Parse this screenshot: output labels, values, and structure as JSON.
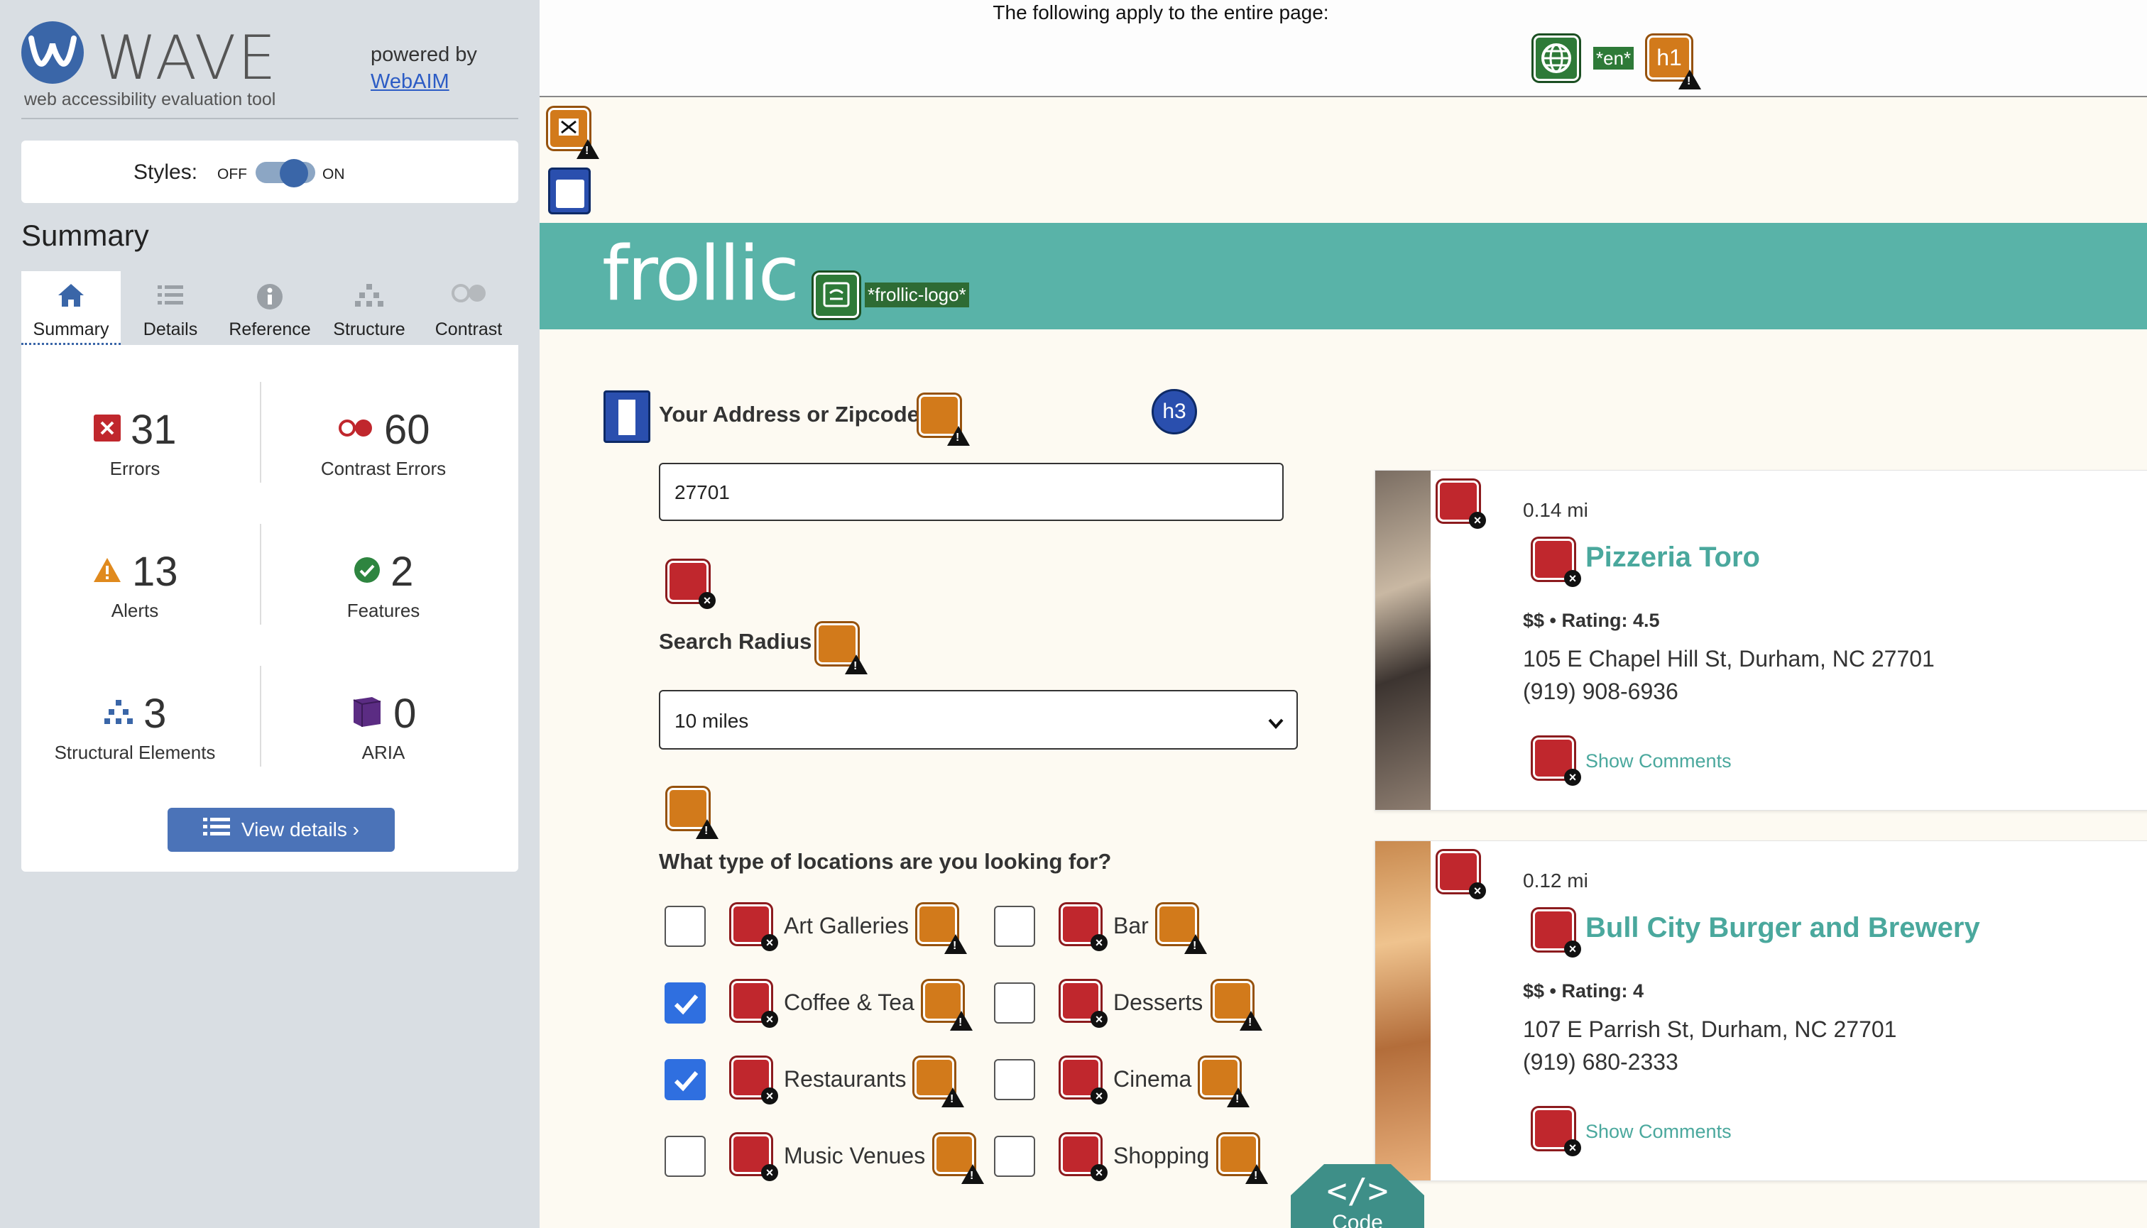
{
  "sidebar": {
    "logo_title": "WAVE",
    "logo_tagline": "web accessibility evaluation tool",
    "powered_by": "powered by",
    "powered_link": "WebAIM",
    "styles_label": "Styles:",
    "styles_off": "OFF",
    "styles_on": "ON",
    "summary_heading": "Summary",
    "tabs": [
      {
        "label": "Summary",
        "icon": "home-icon",
        "active": true
      },
      {
        "label": "Details",
        "icon": "list-icon"
      },
      {
        "label": "Reference",
        "icon": "info-icon"
      },
      {
        "label": "Structure",
        "icon": "sitemap-icon"
      },
      {
        "label": "Contrast",
        "icon": "contrast-icon"
      }
    ],
    "stats": {
      "errors": {
        "value": "31",
        "label": "Errors",
        "color": "#c0272d"
      },
      "contrast_errors": {
        "value": "60",
        "label": "Contrast Errors",
        "color": "#c0272d"
      },
      "alerts": {
        "value": "13",
        "label": "Alerts",
        "color": "#e08a1e"
      },
      "features": {
        "value": "2",
        "label": "Features",
        "color": "#2e8540"
      },
      "structural": {
        "value": "3",
        "label": "Structural Elements",
        "color": "#3a66a8"
      },
      "aria": {
        "value": "0",
        "label": "ARIA",
        "color": "#5b2c83"
      }
    },
    "view_details": "View details ›"
  },
  "main": {
    "topbar_text": "The following apply to the entire page:",
    "lang_badge": "*en*",
    "h1_badge": "h1",
    "logo_text": "frollic",
    "logo_alt": "*frollic-logo*",
    "address_label": "Your Address or Zipcode",
    "h3_badge": "h3",
    "address_value": "27701",
    "radius_label": "Search Radius",
    "radius_value": "10 miles",
    "types_label": "What type of locations are you looking for?",
    "categories": [
      {
        "label": "Art Galleries",
        "checked": false
      },
      {
        "label": "Bar",
        "checked": false
      },
      {
        "label": "Coffee & Tea",
        "checked": true
      },
      {
        "label": "Desserts",
        "checked": false
      },
      {
        "label": "Restaurants",
        "checked": true
      },
      {
        "label": "Cinema",
        "checked": false
      },
      {
        "label": "Music Venues",
        "checked": false
      },
      {
        "label": "Shopping",
        "checked": false
      }
    ],
    "results": [
      {
        "distance": "0.14 mi",
        "name": "Pizzeria Toro",
        "price": "$$",
        "rating": "Rating: 4.5",
        "address": "105 E Chapel Hill St, Durham, NC 27701",
        "phone": "(919) 908-6936",
        "comments": "Show Comments"
      },
      {
        "distance": "0.12 mi",
        "name": "Bull City Burger and Brewery",
        "price": "$$",
        "rating": "Rating: 4",
        "address": "107 E Parrish St, Durham, NC 27701",
        "phone": "(919) 680-2333",
        "comments": "Show Comments"
      }
    ],
    "code_button": "Code",
    "code_glyph": "</>"
  },
  "colors": {
    "brand_teal": "#59b3a8",
    "wave_blue": "#3a66a8",
    "error_red": "#c0272d",
    "alert_orange": "#d27a1b",
    "feature_green": "#2e7a38"
  }
}
